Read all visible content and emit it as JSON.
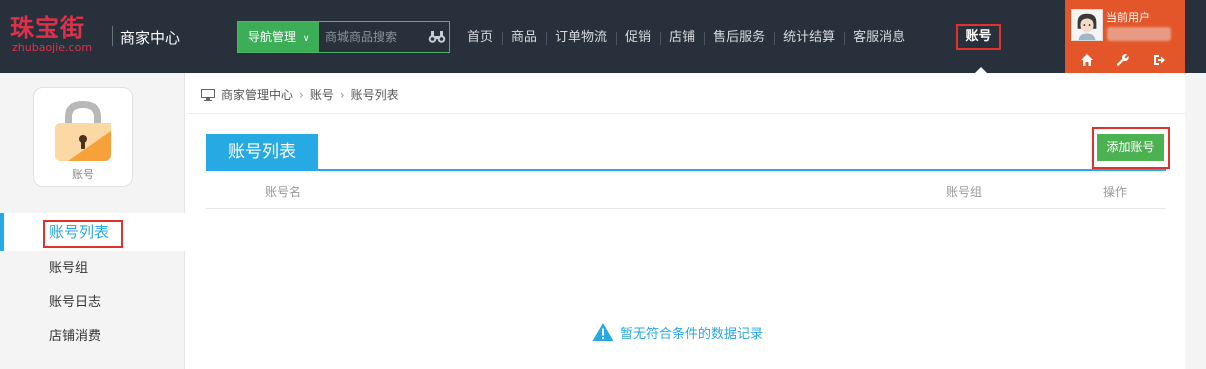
{
  "header": {
    "logo_cn": "珠宝街",
    "logo_en": "zhubaojie.com",
    "title": "商家中心",
    "nav_manage_label": "导航管理",
    "search_placeholder": "商城商品搜索",
    "nav_items": [
      "首页",
      "商品",
      "订单物流",
      "促销",
      "店铺",
      "售后服务",
      "统计结算",
      "客服消息"
    ],
    "nav_active": "账号",
    "user_label": "当前用户"
  },
  "sidebar": {
    "module_label": "账号",
    "items": [
      {
        "label": "账号列表",
        "active": true
      },
      {
        "label": "账号组",
        "active": false
      },
      {
        "label": "账号日志",
        "active": false
      },
      {
        "label": "店铺消费",
        "active": false
      }
    ]
  },
  "main": {
    "breadcrumb": [
      "商家管理中心",
      "账号",
      "账号列表"
    ],
    "tab_title": "账号列表",
    "add_button": "添加账号",
    "columns": [
      "账号名",
      "账号组",
      "操作"
    ],
    "empty_message": "暂无符合条件的数据记录"
  },
  "colors": {
    "topbar": "#27303b",
    "accent_blue": "#27a9e3",
    "green": "#4cb150",
    "user_panel": "#e25629",
    "highlight_red": "#e0312d"
  }
}
